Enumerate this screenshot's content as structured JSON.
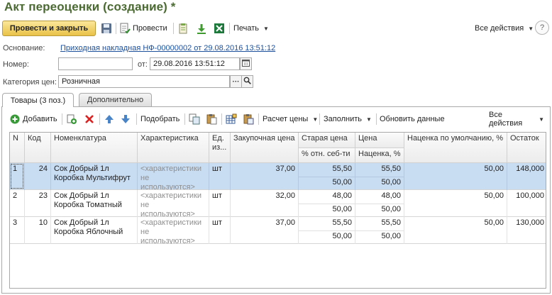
{
  "window": {
    "title": "Акт переоценки (создание) *"
  },
  "toolbar": {
    "post_close": "Провести и закрыть",
    "post": "Провести",
    "print": "Печать",
    "all_actions": "Все действия",
    "help": "?"
  },
  "form": {
    "basis_label": "Основание:",
    "basis_link": "Приходная накладная НФ-00000002 от 29.08.2016 13:51:12",
    "number_label": "Номер:",
    "number_value": "",
    "date_label": "от:",
    "date_value": "29.08.2016 13:51:12",
    "price_category_label": "Категория цен:",
    "price_category_value": "Розничная"
  },
  "tabs": [
    {
      "label": "Товары (3 поз.)",
      "active": true
    },
    {
      "label": "Дополнительно",
      "active": false
    }
  ],
  "table_toolbar": {
    "add": "Добавить",
    "pick": "Подобрать",
    "price_calc": "Расчет цены",
    "fill": "Заполнить",
    "update": "Обновить данные",
    "all_actions": "Все действия"
  },
  "table": {
    "headers": {
      "n": "N",
      "code": "Код",
      "nomenclature": "Номенклатура",
      "characteristic": "Характеристика",
      "unit": "Ед. из...",
      "purchase_price": "Закупочная цена",
      "old_price": "Старая цена",
      "old_price_sub": "% отн. себ-ти",
      "price": "Цена",
      "price_sub": "Наценка, %",
      "default_markup": "Наценка по умолчанию, %",
      "stock": "Остаток"
    },
    "rows": [
      {
        "n": "1",
        "code": "24",
        "name1": "Сок Добрый 1л",
        "name2": "Коробка Мультифрут",
        "char1": "<характеристики",
        "char2": "не используются>",
        "unit": "шт",
        "purchase": "37,00",
        "old": "55,50",
        "old_pct": "50,00",
        "price": "55,50",
        "markup": "50,00",
        "default_markup": "50,00",
        "stock": "148,000"
      },
      {
        "n": "2",
        "code": "23",
        "name1": "Сок Добрый 1л",
        "name2": "Коробка Томатный",
        "char1": "<характеристики",
        "char2": "не используются>",
        "unit": "шт",
        "purchase": "32,00",
        "old": "48,00",
        "old_pct": "50,00",
        "price": "48,00",
        "markup": "50,00",
        "default_markup": "50,00",
        "stock": "100,000"
      },
      {
        "n": "3",
        "code": "10",
        "name1": "Сок Добрый 1л",
        "name2": "Коробка Яблочный",
        "char1": "<характеристики",
        "char2": "не используются>",
        "unit": "шт",
        "purchase": "37,00",
        "old": "55,50",
        "old_pct": "50,00",
        "price": "55,50",
        "markup": "50,00",
        "default_markup": "50,00",
        "stock": "130,000"
      }
    ],
    "selected_row": 0
  },
  "colors": {
    "title": "#4a6a32",
    "link": "#1b4f9c",
    "selection": "#c8dcf2",
    "primary_button": "#e9c248"
  }
}
